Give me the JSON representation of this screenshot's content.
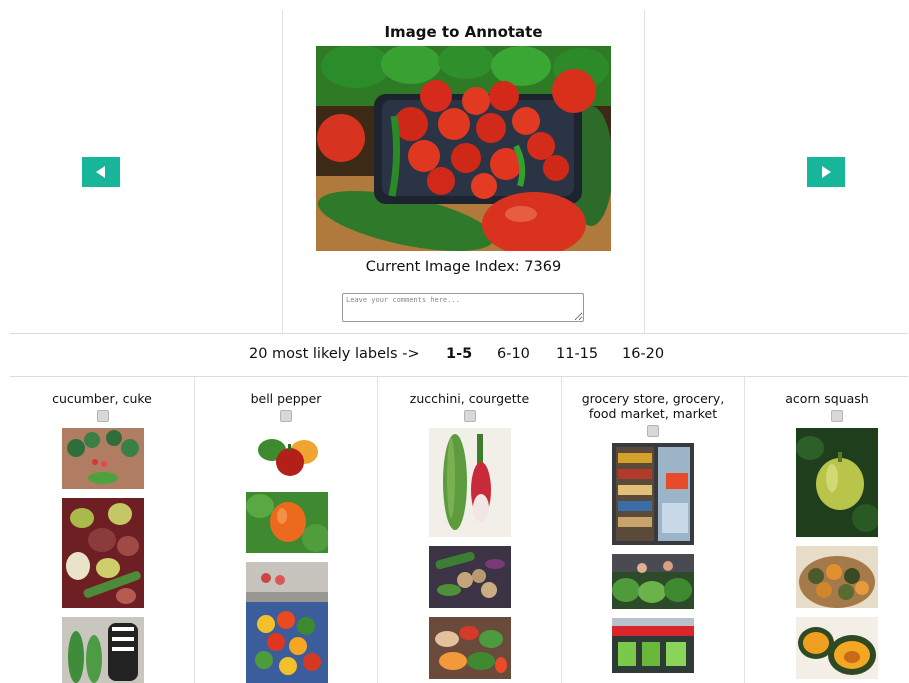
{
  "heading": "Image to Annotate",
  "index_label": "Current Image Index: 7369",
  "comment_placeholder": "Leave your comments here...",
  "nav": {
    "prev_icon": "arrow-left-icon",
    "next_icon": "arrow-right-icon",
    "color": "#17b59a"
  },
  "pager": {
    "intro": "20 most likely labels ->",
    "pages": [
      "1-5",
      "6-10",
      "11-15",
      "16-20"
    ],
    "active_page": "1-5"
  },
  "labels": [
    {
      "name": "cucumber, cuke"
    },
    {
      "name": "bell pepper"
    },
    {
      "name": "zucchini, courgette"
    },
    {
      "name": "grocery store, grocery, food market, market"
    },
    {
      "name": "acorn squash"
    }
  ]
}
